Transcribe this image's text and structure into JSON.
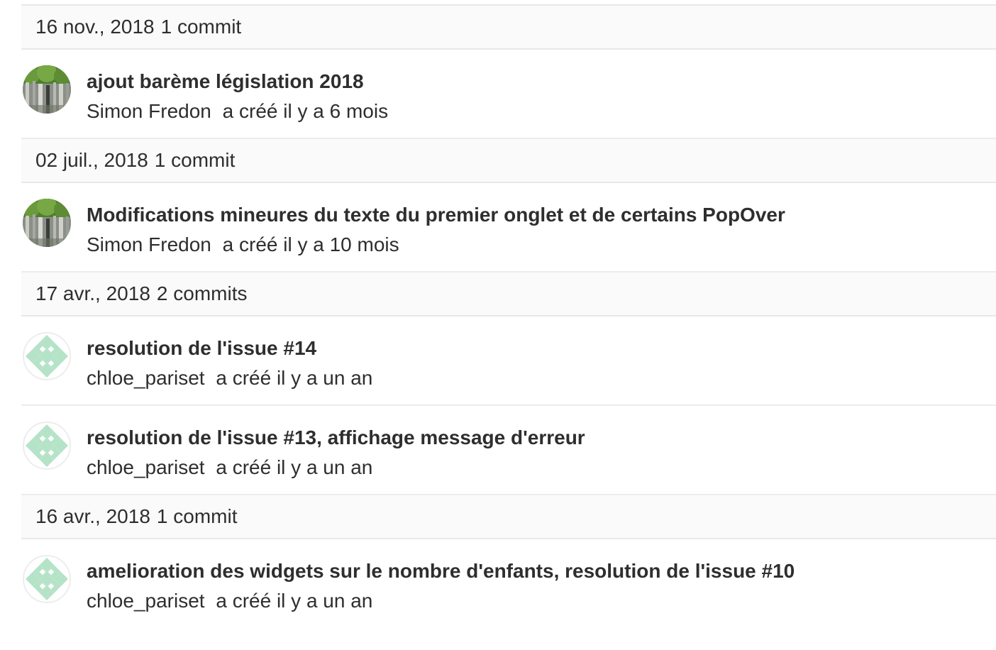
{
  "groups": [
    {
      "date": "16 nov., 2018",
      "count": "1 commit",
      "commits": [
        {
          "title": "ajout barème législation 2018",
          "author": "Simon Fredon",
          "action": "a créé il y a 6 mois",
          "avatar": "photo"
        }
      ]
    },
    {
      "date": "02 juil., 2018",
      "count": "1 commit",
      "commits": [
        {
          "title": "Modifications mineures du texte du premier onglet et de certains PopOver",
          "author": "Simon Fredon",
          "action": "a créé il y a 10 mois",
          "avatar": "photo"
        }
      ]
    },
    {
      "date": "17 avr., 2018",
      "count": "2 commits",
      "commits": [
        {
          "title": "resolution de l'issue #14",
          "author": "chloe_pariset",
          "action": "a créé il y a un an",
          "avatar": "identicon"
        },
        {
          "title": "resolution de l'issue #13, affichage message d'erreur",
          "author": "chloe_pariset",
          "action": "a créé il y a un an",
          "avatar": "identicon"
        }
      ]
    },
    {
      "date": "16 avr., 2018",
      "count": "1 commit",
      "commits": [
        {
          "title": "amelioration des widgets sur le nombre d'enfants, resolution de l'issue #10",
          "author": "chloe_pariset",
          "action": "a créé il y a un an",
          "avatar": "identicon"
        }
      ]
    }
  ],
  "colors": {
    "header_bg": "#fafafa",
    "border": "#e8e8e8",
    "text": "#2e2e2e",
    "identicon": "#b5e3c8"
  }
}
